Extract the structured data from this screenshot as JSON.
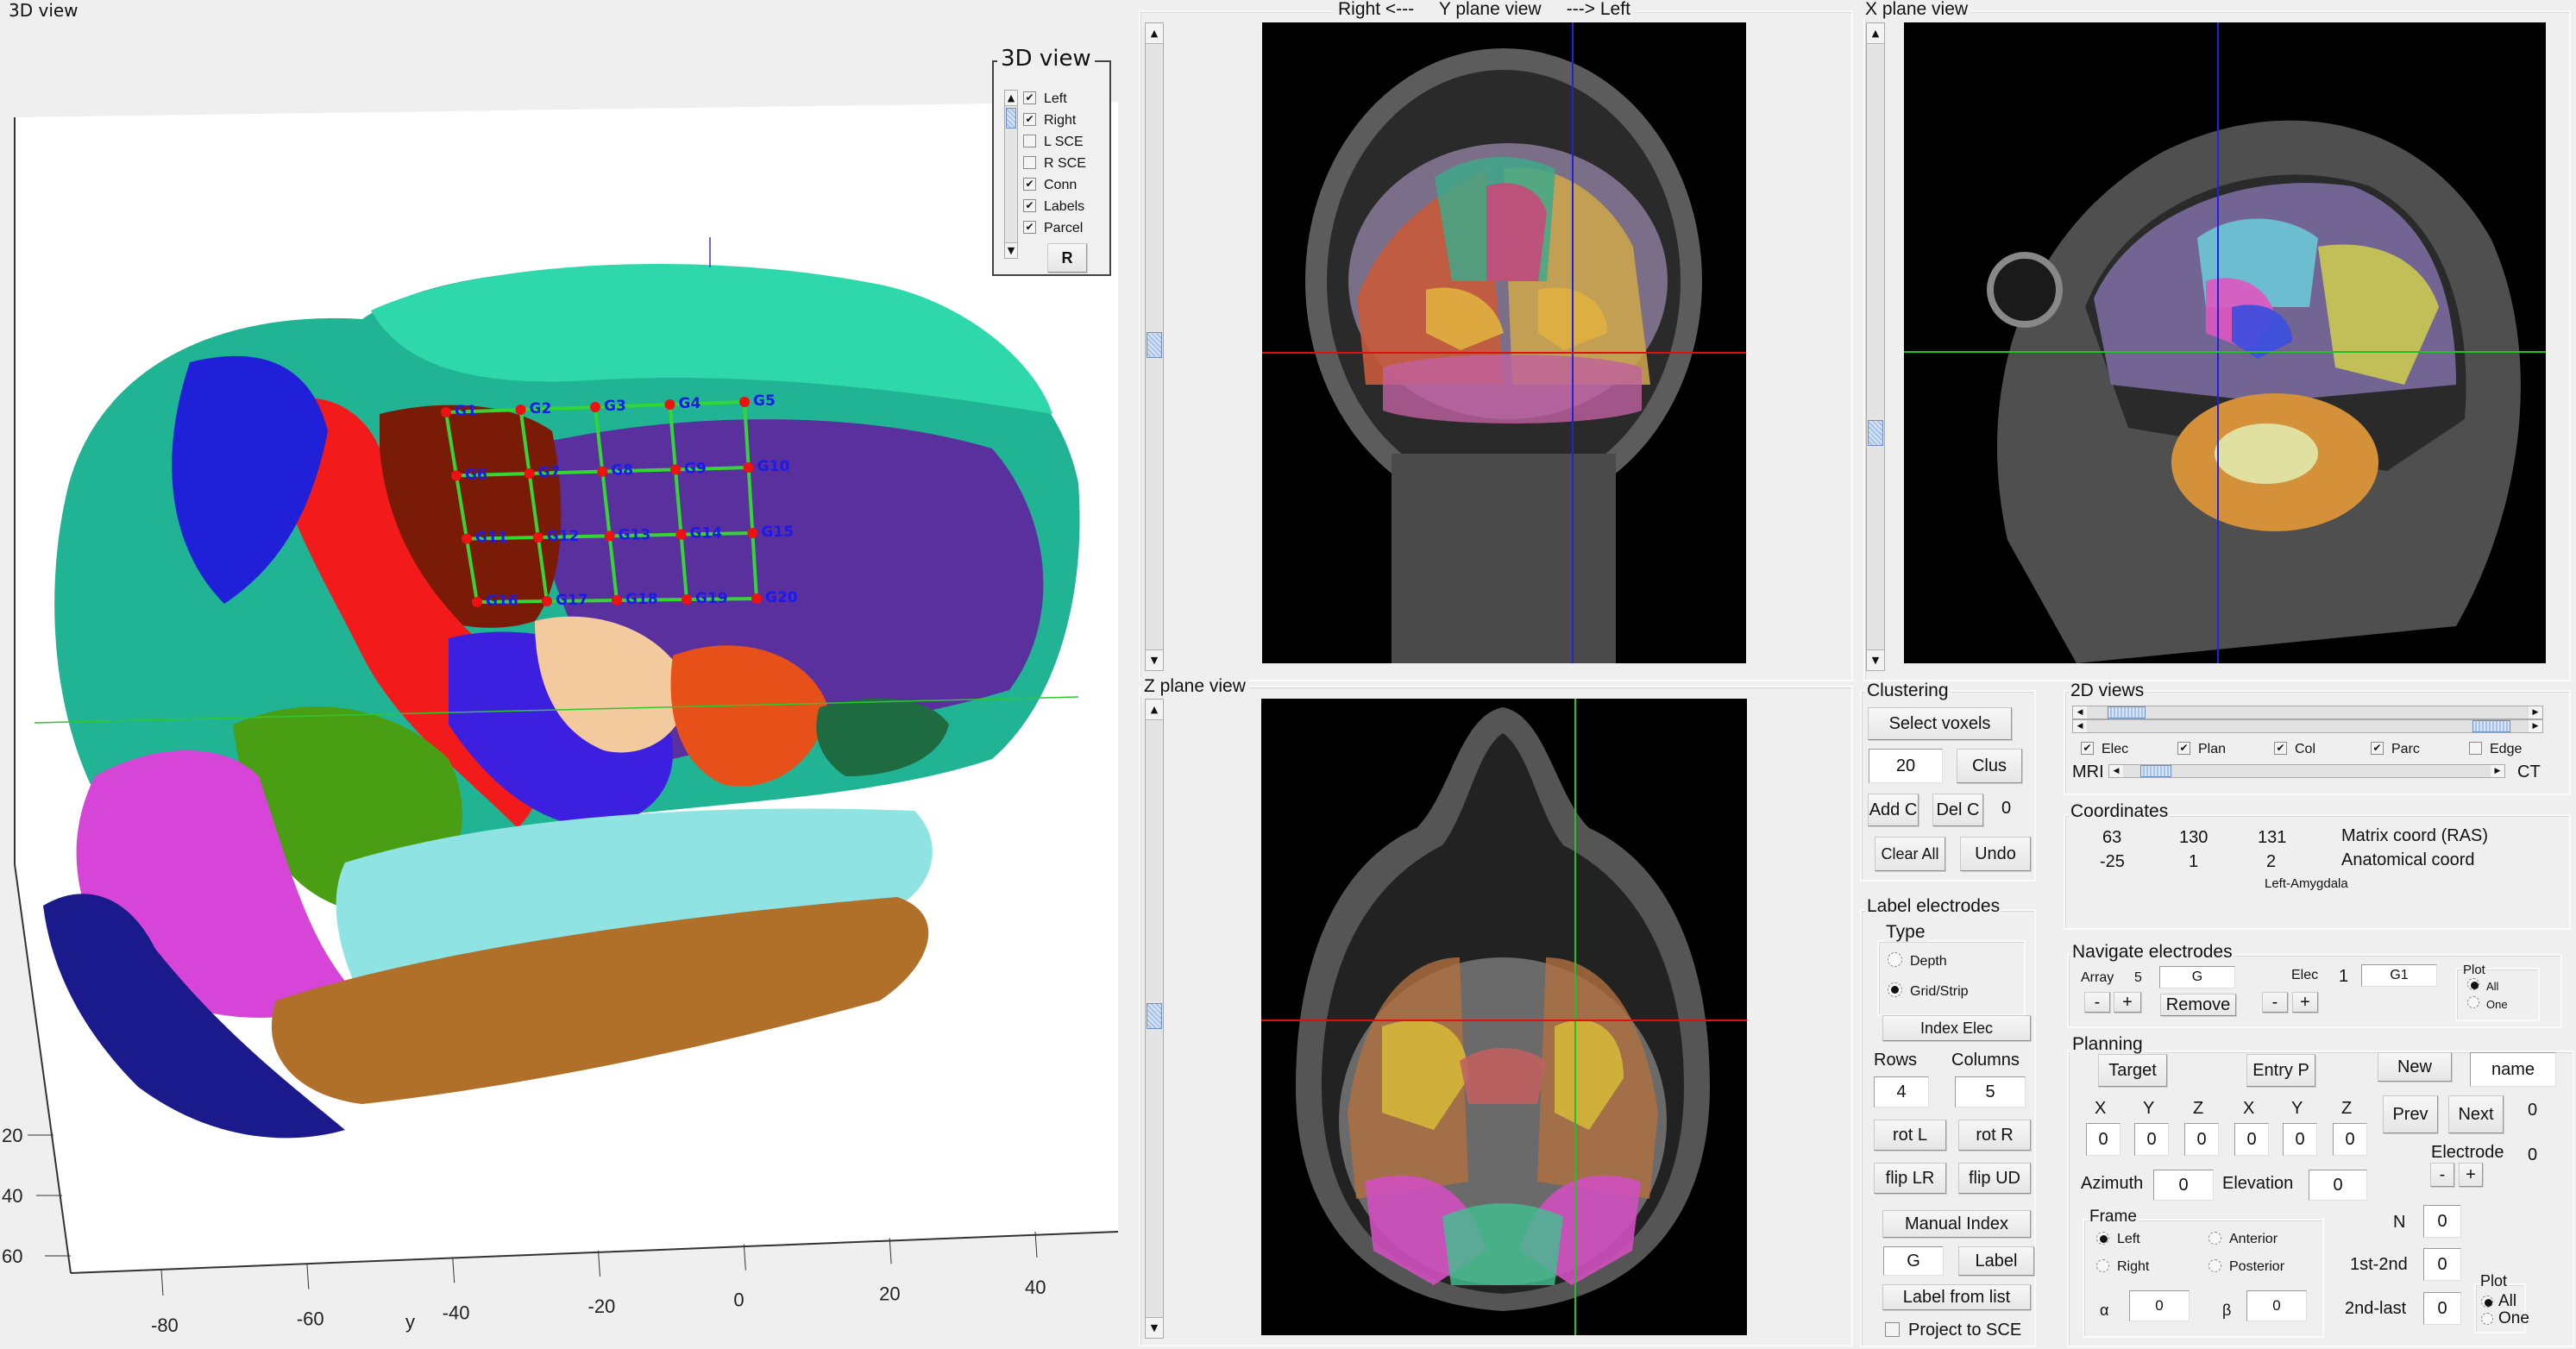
{
  "view3d": {
    "title": "3D view",
    "legend": {
      "title": "3D view",
      "items": [
        {
          "label": "Left",
          "checked": true
        },
        {
          "label": "Right",
          "checked": true
        },
        {
          "label": "L SCE",
          "checked": false
        },
        {
          "label": "R SCE",
          "checked": false
        },
        {
          "label": "Conn",
          "checked": true
        },
        {
          "label": "Labels",
          "checked": true
        },
        {
          "label": "Parcel",
          "checked": true
        }
      ],
      "reset_label": "R"
    },
    "y_axis": {
      "label": "y",
      "ticks": [
        "-80",
        "-60",
        "-40",
        "-20",
        "0",
        "20",
        "40"
      ]
    },
    "z_axis": {
      "ticks": [
        "20",
        "40",
        "60"
      ]
    },
    "grid_electrodes": [
      "G1",
      "G2",
      "G3",
      "G4",
      "G5",
      "G6",
      "G7",
      "G8",
      "G9",
      "G10",
      "G11",
      "G12",
      "G13",
      "G14",
      "G15",
      "G16",
      "G17",
      "G18",
      "G19",
      "G20"
    ],
    "grid_rows": 4,
    "grid_cols": 5
  },
  "yplane": {
    "title_left": "Right <---",
    "title": "Y plane view",
    "title_right": "---> Left"
  },
  "xplane": {
    "title": "X plane view"
  },
  "zplane": {
    "title": "Z plane view"
  },
  "clustering": {
    "title": "Clustering",
    "select_voxels": "Select voxels",
    "cluster_size": "20",
    "clus": "Clus",
    "add_c": "Add C",
    "del_c": "Del C",
    "count": "0",
    "clear_all": "Clear All",
    "undo": "Undo"
  },
  "label_electrodes": {
    "title": "Label electrodes",
    "type_title": "Type",
    "types": [
      {
        "label": "Depth",
        "selected": false
      },
      {
        "label": "Grid/Strip",
        "selected": true
      }
    ],
    "index_elec": "Index Elec",
    "rows_label": "Rows",
    "cols_label": "Columns",
    "rows": "4",
    "cols": "5",
    "rot_l": "rot L",
    "rot_r": "rot R",
    "flip_lr": "flip LR",
    "flip_ud": "flip UD",
    "manual_index": "Manual Index",
    "label_prefix": "G",
    "label_btn": "Label",
    "label_from_list": "Label from list",
    "project_sce": "Project to SCE",
    "project_sce_checked": false
  },
  "views2d": {
    "title": "2D views",
    "checks": [
      {
        "label": "Elec",
        "checked": true
      },
      {
        "label": "Plan",
        "checked": true
      },
      {
        "label": "Col",
        "checked": true
      },
      {
        "label": "Parc",
        "checked": true
      },
      {
        "label": "Edge",
        "checked": false
      }
    ],
    "mri_label": "MRI",
    "ct_label": "CT",
    "slider1": 0.05,
    "slider2": 0.95,
    "mri_ct_mix": 0.05
  },
  "coordinates": {
    "title": "Coordinates",
    "matrix": [
      "63",
      "130",
      "131"
    ],
    "matrix_label": "Matrix coord (RAS)",
    "anatomical": [
      "-25",
      "1",
      "2"
    ],
    "anatomical_label": "Anatomical coord",
    "region": "Left-Amygdala"
  },
  "navigate": {
    "title": "Navigate electrodes",
    "array_label": "Array",
    "array_num": "5",
    "array_name": "G",
    "elec_label": "Elec",
    "elec_num": "1",
    "elec_name": "G1",
    "minus": "-",
    "plus": "+",
    "remove": "Remove",
    "plot_title": "Plot",
    "plot_options": [
      {
        "label": "All",
        "selected": true
      },
      {
        "label": "One",
        "selected": false
      }
    ]
  },
  "planning": {
    "title": "Planning",
    "target": "Target",
    "entry": "Entry P",
    "new": "New",
    "name": "name",
    "prev": "Prev",
    "next": "Next",
    "next_count": "0",
    "target_labels": [
      "X",
      "Y",
      "Z"
    ],
    "entry_labels": [
      "X",
      "Y",
      "Z"
    ],
    "target_xyz": [
      "0",
      "0",
      "0"
    ],
    "entry_xyz": [
      "0",
      "0",
      "0"
    ],
    "azimuth_label": "Azimuth",
    "azimuth": "0",
    "elevation_label": "Elevation",
    "elevation": "0",
    "electrode_label": "Electrode",
    "electrode_count": "0",
    "frame_title": "Frame",
    "frame_options": [
      {
        "label": "Left",
        "selected": true
      },
      {
        "label": "Right",
        "selected": false
      },
      {
        "label": "Anterior",
        "selected": false
      },
      {
        "label": "Posterior",
        "selected": false
      }
    ],
    "alpha_label": "α",
    "alpha": "0",
    "beta_label": "β",
    "beta": "0",
    "n_label": "N",
    "n": "0",
    "first_second_label": "1st-2nd",
    "first_second": "0",
    "second_last_label": "2nd-last",
    "second_last": "0",
    "plot_title": "Plot",
    "plot_options": [
      {
        "label": "All",
        "selected": true
      },
      {
        "label": "One",
        "selected": false
      }
    ]
  }
}
